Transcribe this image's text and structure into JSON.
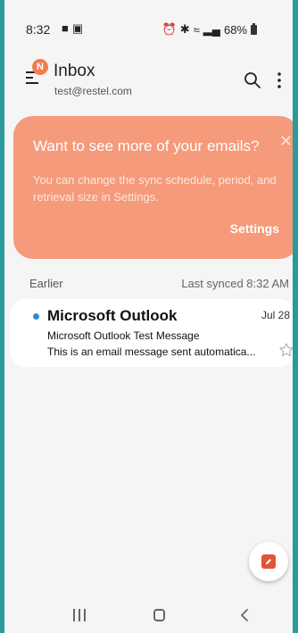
{
  "status_bar": {
    "time": "8:32",
    "left_icons": [
      "chat-icon",
      "image-icon"
    ],
    "right_icons": [
      "alarm-icon",
      "bluetooth-icon",
      "wifi-icon",
      "signal-icon"
    ],
    "battery": "68%"
  },
  "header": {
    "badge": "N",
    "title": "Inbox",
    "account": "test@restel.com"
  },
  "banner": {
    "title": "Want to see more of your emails?",
    "body": "You can change the sync schedule, period, and retrieval size in Settings.",
    "action": "Settings",
    "color": "#f59a7b"
  },
  "section": {
    "label": "Earlier",
    "sync_status": "Last synced  8:32 AM"
  },
  "messages": [
    {
      "sender": "Microsoft Outlook",
      "date": "Jul 28",
      "subject": "Microsoft Outlook Test Message",
      "preview": "This is an email message sent automatica...",
      "unread": true
    }
  ],
  "colors": {
    "frame": "#2a9b9c",
    "accent": "#f07e4e",
    "unread_dot": "#2a8fd6",
    "compose": "#e2543a"
  }
}
